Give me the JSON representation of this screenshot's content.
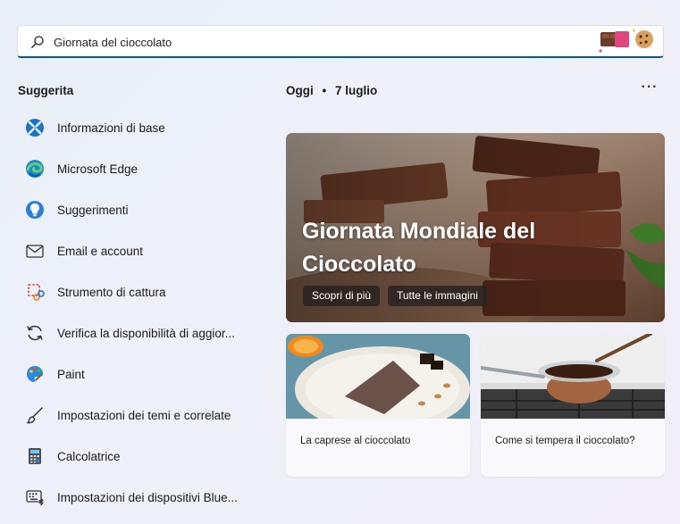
{
  "search": {
    "query": "Giornata del cioccolato"
  },
  "suggested": {
    "title": "Suggerita",
    "items": [
      {
        "label": "Informazioni di base",
        "icon": "info-icon"
      },
      {
        "label": "Microsoft Edge",
        "icon": "edge-icon"
      },
      {
        "label": "Suggerimenti",
        "icon": "tips-icon"
      },
      {
        "label": "Email e account",
        "icon": "mail-icon"
      },
      {
        "label": "Strumento di cattura",
        "icon": "snipping-icon"
      },
      {
        "label": "Verifica la disponibilità di aggior...",
        "icon": "refresh-icon"
      },
      {
        "label": "Paint",
        "icon": "paint-icon"
      },
      {
        "label": "Impostazioni dei temi e correlate",
        "icon": "brush-icon"
      },
      {
        "label": "Calcolatrice",
        "icon": "calculator-icon"
      },
      {
        "label": "Impostazioni dei dispositivi Blue...",
        "icon": "bluetooth-keyboard-icon"
      }
    ]
  },
  "today": {
    "label": "Oggi",
    "date": "7 luglio",
    "more": "···"
  },
  "hero": {
    "title": "Giornata Mondiale del Cioccolato",
    "learn_more": "Scopri di più",
    "all_images": "Tutte le immagini"
  },
  "cards": [
    {
      "caption": "La caprese al cioccolato"
    },
    {
      "caption": "Come si tempera il cioccolato?"
    }
  ],
  "colors": {
    "accent": "#0a5c87",
    "chocolate": "#5a3222"
  }
}
